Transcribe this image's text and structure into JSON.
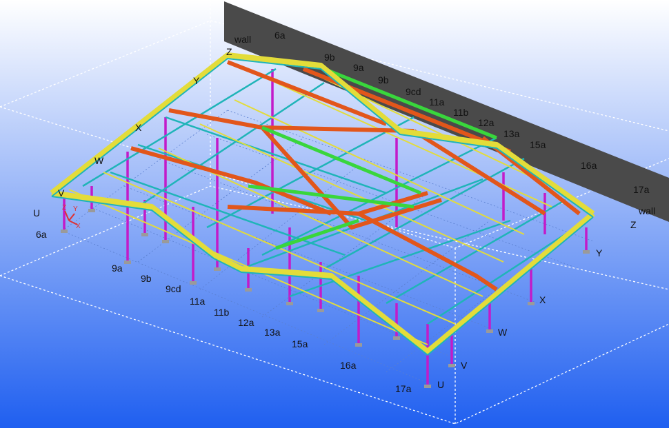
{
  "viewport": {
    "background_top": "#ffffff",
    "background_bottom": "#1f5ff0"
  },
  "wall": {
    "label_top": "wall",
    "label_right": "wall",
    "color": "#4a4a4a"
  },
  "grid_labels_back": [
    "6a",
    "9b",
    "9a",
    "9b",
    "9cd",
    "11a",
    "11b",
    "12a",
    "13a",
    "15a",
    "16a",
    "17a"
  ],
  "grid_labels_front": [
    "6a",
    "9a",
    "9b",
    "9cd",
    "11a",
    "11b",
    "12a",
    "13a",
    "15a",
    "16a",
    "17a"
  ],
  "row_labels_left": [
    "Z",
    "Y",
    "X",
    "W",
    "V",
    "U"
  ],
  "row_labels_right": [
    "Z",
    "Y",
    "X",
    "W",
    "V",
    "U"
  ],
  "member_colors": {
    "yellow": "#e3dc3a",
    "orange": "#e2561b",
    "cyan": "#1fb4b8",
    "green": "#39d63c",
    "magenta": "#c21bc9",
    "gray": "#8a8a8a"
  },
  "axis_gizmo": [
    "Z",
    "Y",
    "X"
  ]
}
